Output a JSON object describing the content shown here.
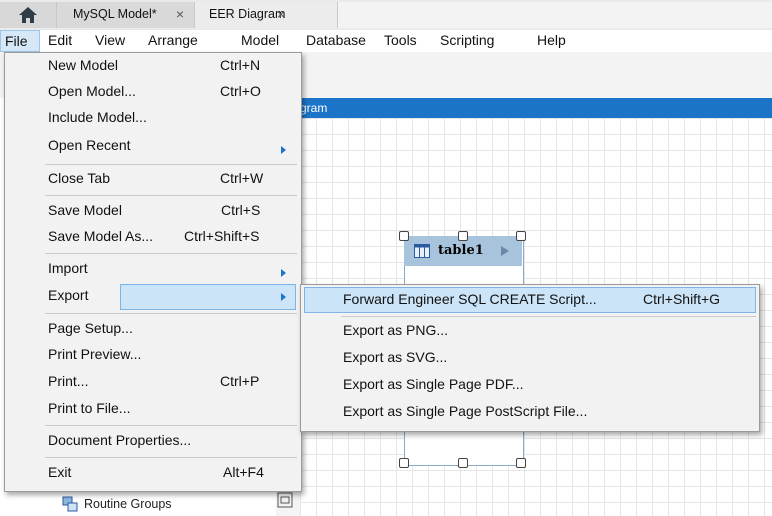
{
  "tabs": [
    {
      "label": "MySQL Model*",
      "close": "×"
    },
    {
      "label": "EER Diagram",
      "close": "×"
    }
  ],
  "menubar": [
    "File",
    "Edit",
    "View",
    "Arrange",
    "Model",
    "Database",
    "Tools",
    "Scripting",
    "Help"
  ],
  "diagram": {
    "header_label": "gram",
    "table_name": "table1"
  },
  "sidebar": {
    "routine_groups": "Routine Groups"
  },
  "file_menu": [
    {
      "label": "New Model",
      "shortcut": "Ctrl+N"
    },
    {
      "label": "Open Model...",
      "shortcut": "Ctrl+O"
    },
    {
      "label": "Include Model...",
      "shortcut": ""
    },
    {
      "label": "Open Recent",
      "shortcut": ""
    },
    {
      "label": "Close Tab",
      "shortcut": "Ctrl+W"
    },
    {
      "label": "Save Model",
      "shortcut": "Ctrl+S"
    },
    {
      "label": "Save Model As...",
      "shortcut": "Ctrl+Shift+S"
    },
    {
      "label": "Import",
      "shortcut": ""
    },
    {
      "label": "Export",
      "shortcut": ""
    },
    {
      "label": "Page Setup...",
      "shortcut": ""
    },
    {
      "label": "Print Preview...",
      "shortcut": ""
    },
    {
      "label": "Print...",
      "shortcut": "Ctrl+P"
    },
    {
      "label": "Print to File...",
      "shortcut": ""
    },
    {
      "label": "Document Properties...",
      "shortcut": ""
    },
    {
      "label": "Exit",
      "shortcut": "Alt+F4"
    }
  ],
  "export_menu": [
    {
      "label": "Forward Engineer SQL CREATE Script...",
      "shortcut": "Ctrl+Shift+G"
    },
    {
      "label": "Export as PNG...",
      "shortcut": ""
    },
    {
      "label": "Export as SVG...",
      "shortcut": ""
    },
    {
      "label": "Export as Single Page PDF...",
      "shortcut": ""
    },
    {
      "label": "Export as Single Page PostScript File...",
      "shortcut": ""
    }
  ],
  "colors": {
    "accent": "#1b74c8",
    "highlight": "#cce4f7",
    "table_header": "#a8c4dc"
  }
}
